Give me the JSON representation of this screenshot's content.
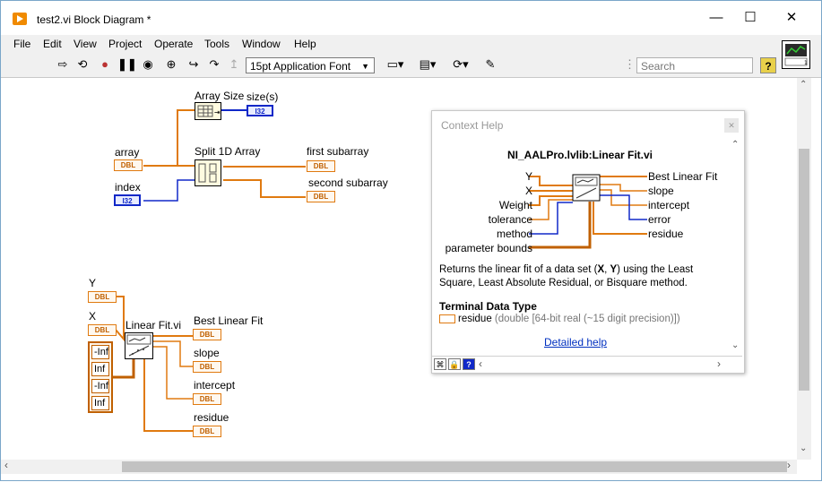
{
  "window": {
    "title": "test2.vi Block Diagram *",
    "minimize": "—",
    "maximize": "☐",
    "close": "✕"
  },
  "menu": [
    "File",
    "Edit",
    "View",
    "Project",
    "Operate",
    "Tools",
    "Window",
    "Help"
  ],
  "toolbar": {
    "font": "15pt Application Font",
    "search_placeholder": "Search",
    "help_label": "?"
  },
  "diagram": {
    "array_size_label": "Array Size",
    "sizes_label": "size(s)",
    "array_label": "array",
    "index_label": "index",
    "split_label": "Split 1D Array",
    "first_sub_label": "first subarray",
    "second_sub_label": "second subarray",
    "y_label": "Y",
    "x_label": "X",
    "linear_fit_label": "Linear Fit.vi",
    "best_fit_label": "Best Linear Fit",
    "slope_label": "slope",
    "intercept_label": "intercept",
    "residue_label": "residue",
    "dbl": "DBL",
    "i32": "I32",
    "constants": [
      "-Inf",
      "Inf",
      "-Inf",
      "Inf"
    ]
  },
  "context_help": {
    "title": "Context Help",
    "vi_name": "NI_AALPro.lvlib:Linear Fit.vi",
    "inputs": [
      "Y",
      "X",
      "Weight",
      "tolerance",
      "method",
      "parameter bounds"
    ],
    "outputs": [
      "Best Linear Fit",
      "slope",
      "intercept",
      "error",
      "residue"
    ],
    "description_pre": "Returns the linear fit of a data set (",
    "description_x": "X",
    "description_mid": ", ",
    "description_y": "Y",
    "description_post": ") using the Least Square, Least Absolute Residual, or Bisquare method.",
    "terminal_heading": "Terminal Data Type",
    "terminal_name": "residue",
    "terminal_type": " (double [64-bit real (~15 digit precision)])",
    "detailed_help": "Detailed help"
  },
  "colors": {
    "orange_wire": "#e07a10",
    "blue_wire": "#1028c8",
    "array_wire": "#c06000"
  }
}
